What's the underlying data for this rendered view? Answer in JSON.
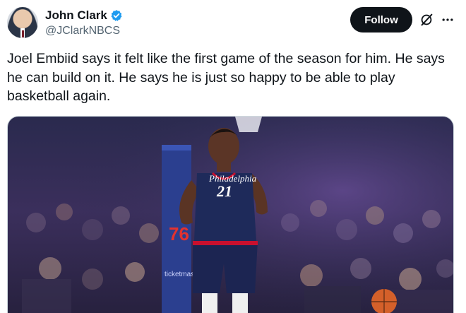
{
  "author": {
    "display_name": "John Clark",
    "handle": "@JClarkNBCS",
    "verified": true,
    "avatar_icon": "avatar-photo"
  },
  "actions": {
    "follow_label": "Follow",
    "grok_icon": "grok-icon",
    "more_icon": "more-icon"
  },
  "tweet": {
    "text": "Joel Embiid says it felt like the first game of the season for him. He says he can build on it. He says he is just so happy to be able to play basketball again."
  },
  "media": {
    "jersey_team": "Philadelphia",
    "jersey_number": "21",
    "sign_number": "76",
    "ad_text": "ticketmaster"
  },
  "colors": {
    "text": "#0f1419",
    "secondary": "#536471",
    "verified": "#1d9bf0",
    "follow_bg": "#0f1419"
  }
}
